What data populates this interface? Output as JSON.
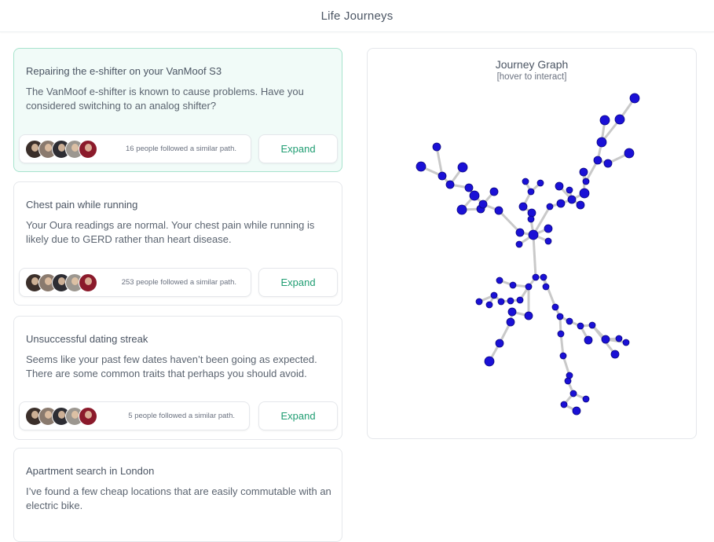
{
  "header": {
    "title": "Life Journeys"
  },
  "journeys": [
    {
      "title": "Repairing the e-shifter on your VanMoof S3",
      "body": "The VanMoof e-shifter is known to cause problems. Have you considered switching to an analog shifter?",
      "people_text": "16 people followed a similar path.",
      "expand_label": "Expand",
      "active": true
    },
    {
      "title": "Chest pain while running",
      "body": "Your Oura readings are normal. Your chest pain while running is likely due to GERD rather than heart disease.",
      "people_text": "253 people followed a similar path.",
      "expand_label": "Expand",
      "active": false
    },
    {
      "title": "Unsuccessful dating streak",
      "body": "Seems like your past few dates haven’t been going as expected. There are some common traits that perhaps you should avoid.",
      "people_text": "5 people followed a similar path.",
      "expand_label": "Expand",
      "active": false
    },
    {
      "title": "Apartment search in London",
      "body": "I’ve found a few cheap locations that are easily commutable with an electric bike.",
      "active": false
    }
  ],
  "graph": {
    "title": "Journey Graph",
    "subtitle": "[hover to interact]",
    "node_color": "#1a10d6",
    "edge_color": "#c9c9c9"
  },
  "avatar_colors": [
    "#3b2f2a",
    "#8a7a6e",
    "#2d2d33",
    "#9c9790",
    "#8b1a2b"
  ]
}
